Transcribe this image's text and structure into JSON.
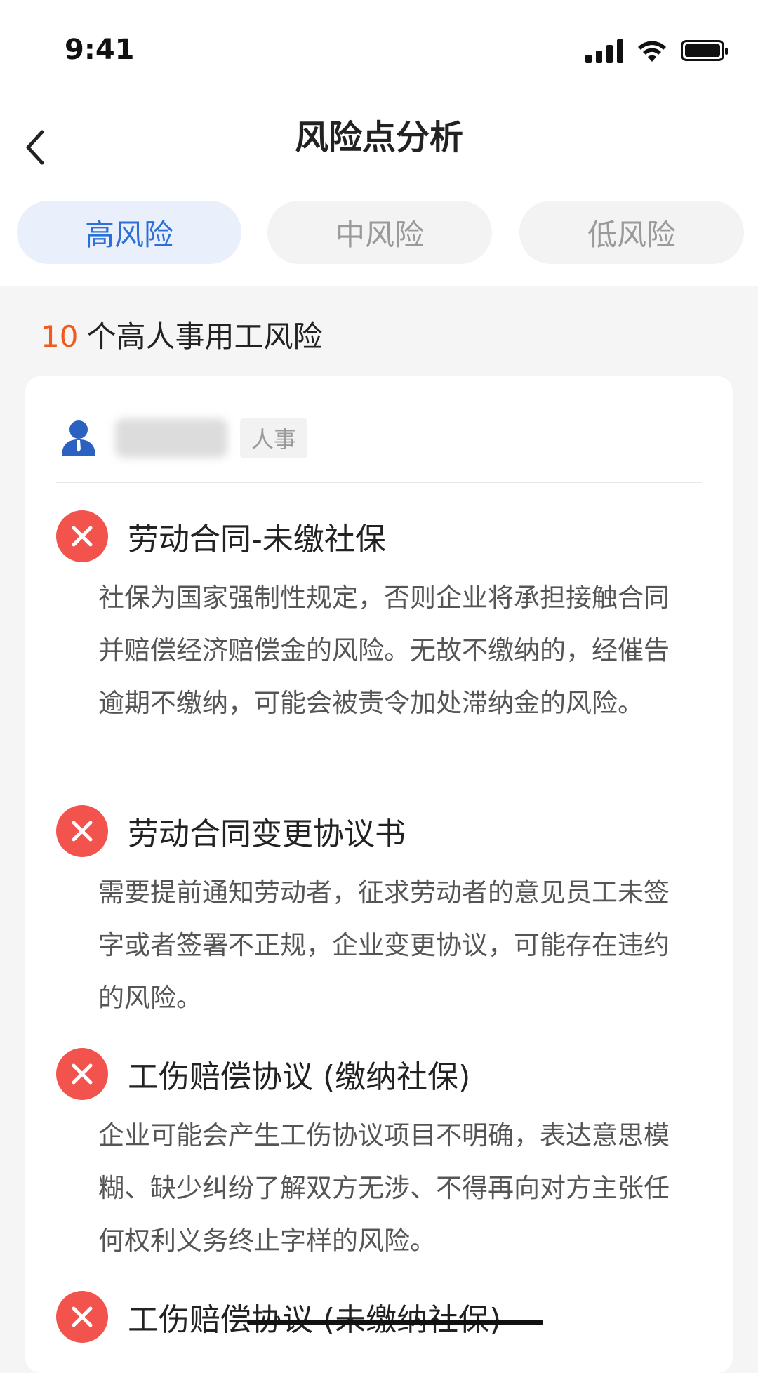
{
  "status": {
    "time": "9:41"
  },
  "header": {
    "title": "风险点分析"
  },
  "tabs": [
    {
      "label": "高风险",
      "active": true
    },
    {
      "label": "中风险",
      "active": false
    },
    {
      "label": "低风险",
      "active": false
    }
  ],
  "summary": {
    "count": "10",
    "label": "个高人事用工风险"
  },
  "card": {
    "user": {
      "name": "",
      "role": "人事"
    },
    "risks": [
      {
        "title": "劳动合同-未缴社保",
        "desc": "社保为国家强制性规定，否则企业将承担接触合同并赔偿经济赔偿金的风险。无故不缴纳的，经催告逾期不缴纳，可能会被责令加处滞纳金的风险。"
      },
      {
        "title": "劳动合同变更协议书",
        "desc": "需要提前通知劳动者，征求劳动者的意见员工未签字或者签署不正规，企业变更协议，可能存在违约的风险。"
      },
      {
        "title": "工伤赔偿协议 (缴纳社保)",
        "desc": "企业可能会产生工伤协议项目不明确，表达意思模糊、缺少纠纷了解双方无涉、不得再向对方主张任何权利义务终止字样的风险。"
      },
      {
        "title": "工伤赔偿协议 (未缴纳社保)",
        "desc": ""
      }
    ]
  },
  "colors": {
    "accent": "#2d6fd6",
    "danger": "#f2544d",
    "count": "#f05a1c"
  }
}
